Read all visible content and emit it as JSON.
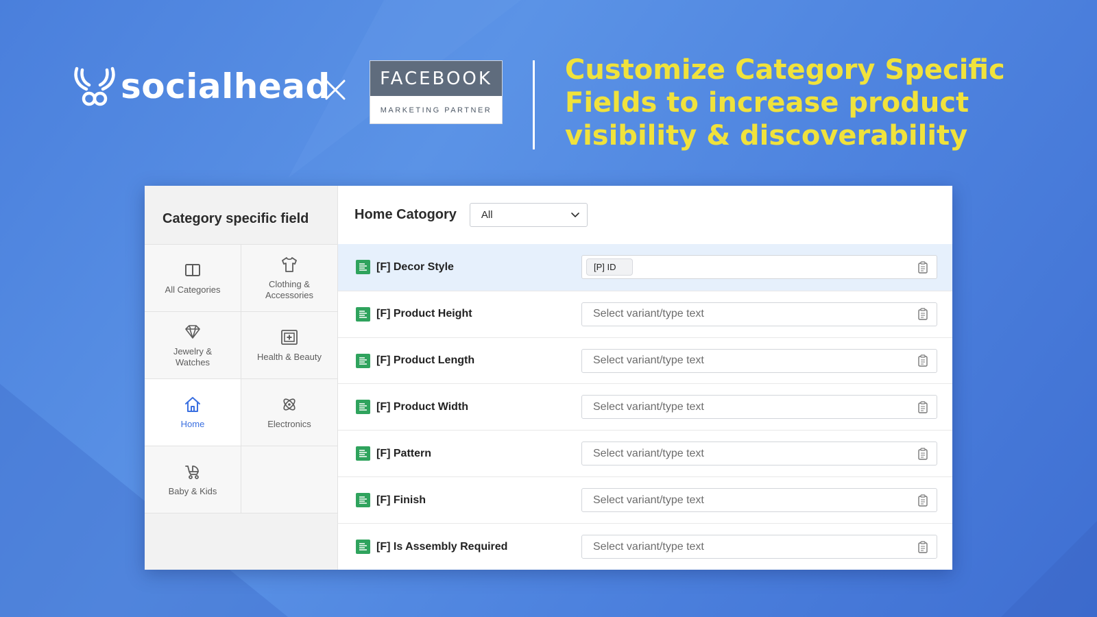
{
  "brand": {
    "name": "socialhead",
    "logo_icon": "antler-logo-icon",
    "separator_icon": "times-icon"
  },
  "partner_badge": {
    "top": "FACEBOOK",
    "bottom": "MARKETING PARTNER"
  },
  "headline": "Customize Category Specific Fields to increase product visibility & discoverability",
  "colors": {
    "headline": "#f0e23c",
    "accent": "#3a6fe0",
    "field_icon": "#2fa35d",
    "highlight_row": "#e6f0fc"
  },
  "sidebar": {
    "title": "Category specific field",
    "categories": [
      {
        "label": "All Categories",
        "icon": "columns-icon"
      },
      {
        "label": "Clothing & Accessories",
        "icon": "tshirt-icon"
      },
      {
        "label": "Jewelry & Watches",
        "icon": "diamond-icon"
      },
      {
        "label": "Health & Beauty",
        "icon": "medical-box-icon"
      },
      {
        "label": "Home",
        "icon": "house-icon",
        "active": true
      },
      {
        "label": "Electronics",
        "icon": "atom-icon"
      },
      {
        "label": "Baby & Kids",
        "icon": "stroller-icon"
      }
    ]
  },
  "main": {
    "title": "Home Catogory",
    "filter": {
      "value": "All"
    },
    "fields": [
      {
        "label": "[F] Decor Style",
        "tag": "[P] ID",
        "placeholder": ""
      },
      {
        "label": "[F] Product Height",
        "placeholder": "Select variant/type text"
      },
      {
        "label": "[F] Product Length",
        "placeholder": "Select variant/type text"
      },
      {
        "label": "[F] Product Width",
        "placeholder": "Select variant/type text"
      },
      {
        "label": "[F] Pattern",
        "placeholder": "Select variant/type text"
      },
      {
        "label": "[F] Finish",
        "placeholder": "Select variant/type text"
      },
      {
        "label": "[F] Is Assembly Required",
        "placeholder": "Select variant/type text"
      }
    ]
  }
}
